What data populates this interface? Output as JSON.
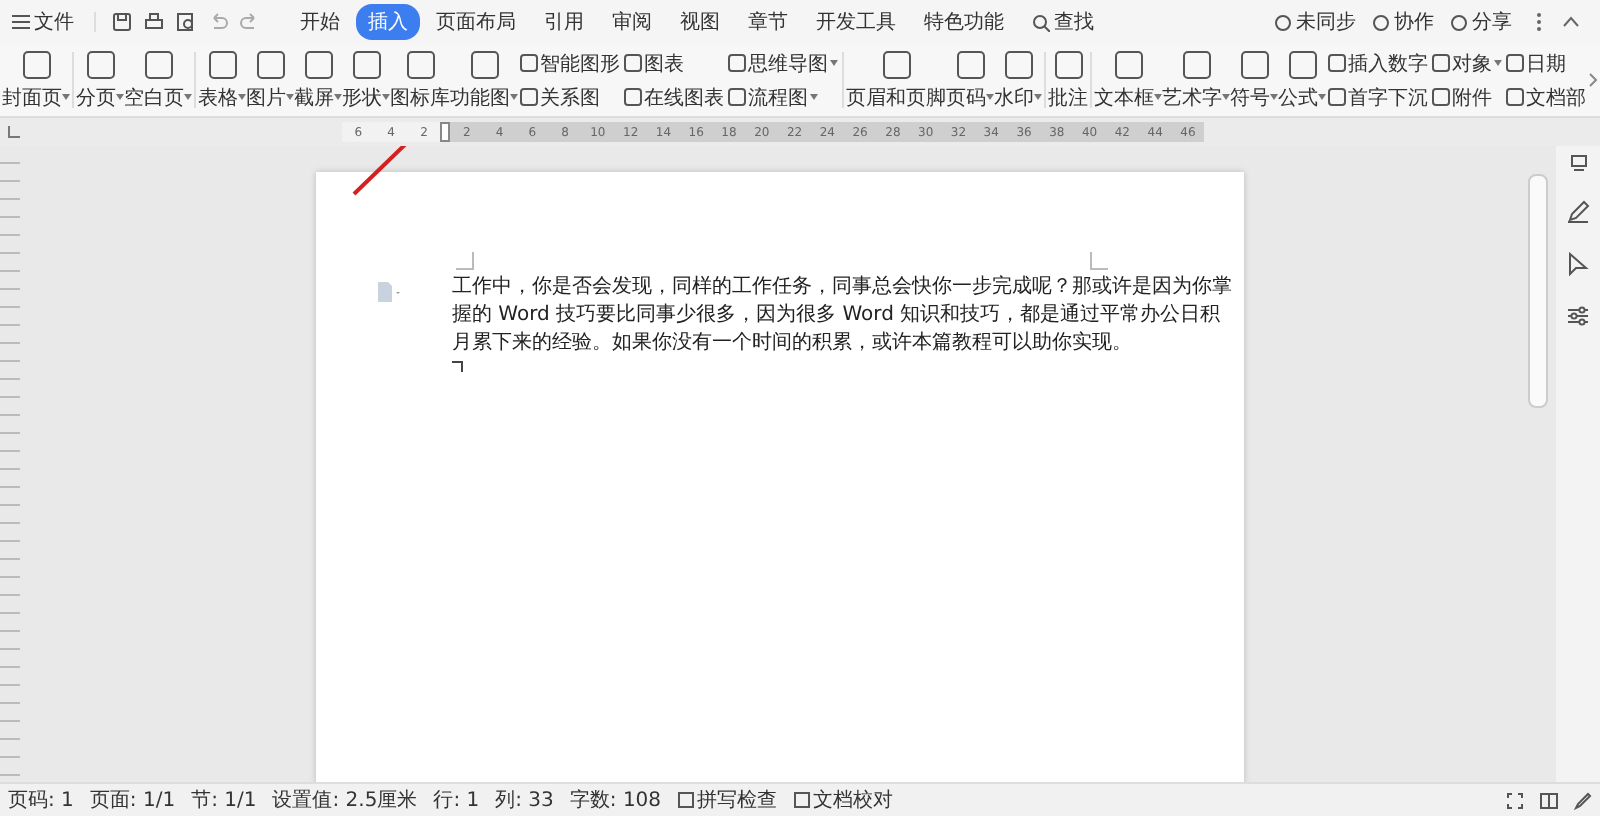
{
  "menu": {
    "label": "文件"
  },
  "tabs": [
    {
      "label": "开始",
      "selected": false
    },
    {
      "label": "插入",
      "selected": true
    },
    {
      "label": "页面布局",
      "selected": false
    },
    {
      "label": "引用",
      "selected": false
    },
    {
      "label": "审阅",
      "selected": false
    },
    {
      "label": "视图",
      "selected": false
    },
    {
      "label": "章节",
      "selected": false
    },
    {
      "label": "开发工具",
      "selected": false
    },
    {
      "label": "特色功能",
      "selected": false
    }
  ],
  "search": {
    "label": "查找"
  },
  "top_actions": [
    {
      "label": "未同步"
    },
    {
      "label": "协作"
    },
    {
      "label": "分享"
    }
  ],
  "ribbon_groups": [
    [
      {
        "kind": "large",
        "label": "封面页",
        "dropdown": true
      }
    ],
    [
      {
        "kind": "large",
        "label": "分页",
        "dropdown": true
      },
      {
        "kind": "large",
        "label": "空白页",
        "dropdown": true
      }
    ],
    [
      {
        "kind": "large",
        "label": "表格",
        "dropdown": true
      },
      {
        "kind": "large",
        "label": "图片",
        "dropdown": true
      },
      {
        "kind": "large",
        "label": "截屏",
        "dropdown": true
      },
      {
        "kind": "large",
        "label": "形状",
        "dropdown": true
      },
      {
        "kind": "large",
        "label": "图标库",
        "dropdown": false
      },
      {
        "kind": "large",
        "label": "功能图",
        "dropdown": true
      },
      {
        "kind": "pair",
        "items": [
          {
            "label": "智能图形",
            "dropdown": false
          },
          {
            "label": "关系图",
            "dropdown": false
          }
        ]
      },
      {
        "kind": "pair",
        "items": [
          {
            "label": "图表",
            "dropdown": false
          },
          {
            "label": "在线图表",
            "dropdown": false
          }
        ]
      },
      {
        "kind": "pair",
        "items": [
          {
            "label": "思维导图",
            "dropdown": true
          },
          {
            "label": "流程图",
            "dropdown": true
          }
        ]
      }
    ],
    [
      {
        "kind": "large",
        "label": "页眉和页脚",
        "dropdown": false
      },
      {
        "kind": "large",
        "label": "页码",
        "dropdown": true
      },
      {
        "kind": "large",
        "label": "水印",
        "dropdown": true
      }
    ],
    [
      {
        "kind": "large",
        "label": "批注",
        "dropdown": false
      }
    ],
    [
      {
        "kind": "large",
        "label": "文本框",
        "dropdown": true
      },
      {
        "kind": "large",
        "label": "艺术字",
        "dropdown": true
      },
      {
        "kind": "large",
        "label": "符号",
        "dropdown": true
      },
      {
        "kind": "large",
        "label": "公式",
        "dropdown": true
      },
      {
        "kind": "pair",
        "items": [
          {
            "label": "插入数字",
            "dropdown": false
          },
          {
            "label": "首字下沉",
            "dropdown": false
          }
        ]
      },
      {
        "kind": "pair",
        "items": [
          {
            "label": "对象",
            "dropdown": true
          },
          {
            "label": "附件",
            "dropdown": false
          }
        ]
      },
      {
        "kind": "pair",
        "items": [
          {
            "label": "日期",
            "dropdown": false
          },
          {
            "label": "文档部",
            "dropdown": false
          }
        ]
      }
    ]
  ],
  "ruler": {
    "left_labels": [
      "6",
      "4",
      "2"
    ],
    "right_labels": [
      "2",
      "4",
      "6",
      "8",
      "10",
      "12",
      "14",
      "16",
      "18",
      "20",
      "22",
      "24",
      "26",
      "28",
      "30",
      "32",
      "34",
      "36",
      "38",
      "40",
      "42",
      "44",
      "46"
    ]
  },
  "document": {
    "paragraph": "工作中，你是否会发现，同样的工作任务，同事总会快你一步完成呢？那或许是因为你掌握的 Word 技巧要比同事少很多，因为很多 Word 知识和技巧，都是通过平常办公日积月累下来的经验。如果你没有一个时间的积累，或许本篇教程可以助你实现。"
  },
  "status_bar": {
    "items": [
      "页码: 1",
      "页面: 1/1",
      "节: 1/1",
      "设置值: 2.5厘米",
      "行: 1",
      "列: 33",
      "字数: 108"
    ],
    "tools": [
      "拼写检查",
      "文档校对"
    ]
  }
}
